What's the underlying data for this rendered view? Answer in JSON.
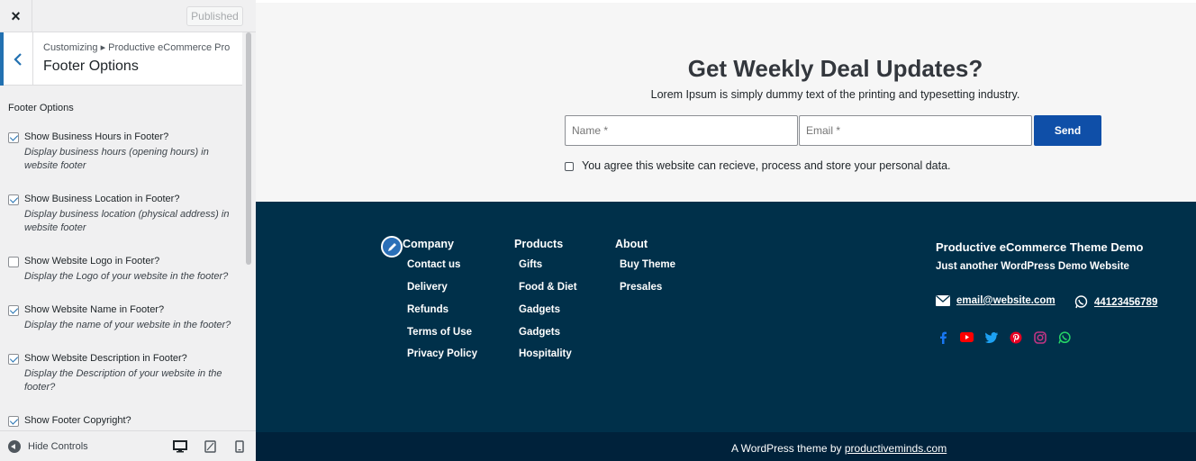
{
  "sidebar": {
    "close_label": "×",
    "published_label": "Published",
    "breadcrumb": "Customizing ▸ Productive eCommerce Pro",
    "section_title": "Footer Options",
    "controls_title": "Footer Options",
    "options": [
      {
        "label": "Show Business Hours in Footer?",
        "desc": "Display business hours (opening hours) in website footer",
        "checked": true
      },
      {
        "label": "Show Business Location in Footer?",
        "desc": "Display business location (physical address) in website footer",
        "checked": true
      },
      {
        "label": "Show Website Logo in Footer?",
        "desc": "Display the Logo of your website in the footer?",
        "checked": false
      },
      {
        "label": "Show Website Name in Footer?",
        "desc": "Display the name of your website in the footer?",
        "checked": true
      },
      {
        "label": "Show Website Description in Footer?",
        "desc": "Display the Description of your website in the footer?",
        "checked": true
      },
      {
        "label": "Show Footer Copyright?",
        "desc": "",
        "checked": true
      }
    ],
    "hide_controls_label": "Hide Controls",
    "devices": [
      "desktop-icon",
      "tablet-icon",
      "mobile-icon"
    ]
  },
  "newsletter": {
    "title": "Get Weekly Deal Updates?",
    "subtitle": "Lorem Ipsum is simply dummy text of the printing and typesetting industry.",
    "name_placeholder": "Name *",
    "email_placeholder": "Email *",
    "send_label": "Send",
    "agree_text": "You agree this website can recieve, process and store your personal data."
  },
  "footer": {
    "columns": [
      {
        "title": "Company",
        "links": [
          "Contact us",
          "Delivery",
          "Refunds",
          "Terms of Use",
          "Privacy Policy"
        ]
      },
      {
        "title": "Products",
        "links": [
          "Gifts",
          "Food & Diet",
          "Gadgets",
          "Gadgets",
          "Hospitality"
        ]
      },
      {
        "title": "About",
        "links": [
          "Buy Theme",
          "Presales"
        ]
      }
    ],
    "site_title": "Productive eCommerce Theme Demo",
    "site_description": "Just another WordPress Demo Website",
    "email": "email@website.com",
    "phone": "44123456789",
    "social": [
      {
        "icon": "facebook-icon",
        "color": "#1877f2"
      },
      {
        "icon": "youtube-icon",
        "color": "#ff0000"
      },
      {
        "icon": "twitter-icon",
        "color": "#1da1f2"
      },
      {
        "icon": "pinterest-icon",
        "color": "#e60023"
      },
      {
        "icon": "instagram-icon",
        "color": "#c13584"
      },
      {
        "icon": "whatsapp-icon",
        "color": "#25d366"
      }
    ],
    "credit_prefix": "A WordPress theme by",
    "credit_link": "productiveminds.com"
  },
  "colors": {
    "accent": "#2271b1",
    "send_button": "#0f4fa8",
    "footer_bg": "#00304a",
    "bottom_bar_bg": "#00223b"
  }
}
